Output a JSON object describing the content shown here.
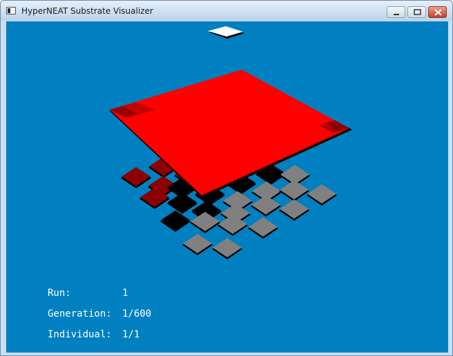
{
  "window": {
    "title": "HyperNEAT Substrate Visualizer",
    "controls": [
      "minimize",
      "maximize",
      "close"
    ]
  },
  "hud": {
    "run_label": "Run:",
    "run_value": "1",
    "generation_label": "Generation:",
    "generation_value": "1/600",
    "individual_label": "Individual:",
    "individual_value": "1/1"
  },
  "colors": {
    "background": "#0080c0",
    "hidden_layer": "#ff0000",
    "output_node": "#ffffff",
    "input_red": "#8b0000",
    "input_black": "#000000",
    "input_gray": "#808080"
  }
}
